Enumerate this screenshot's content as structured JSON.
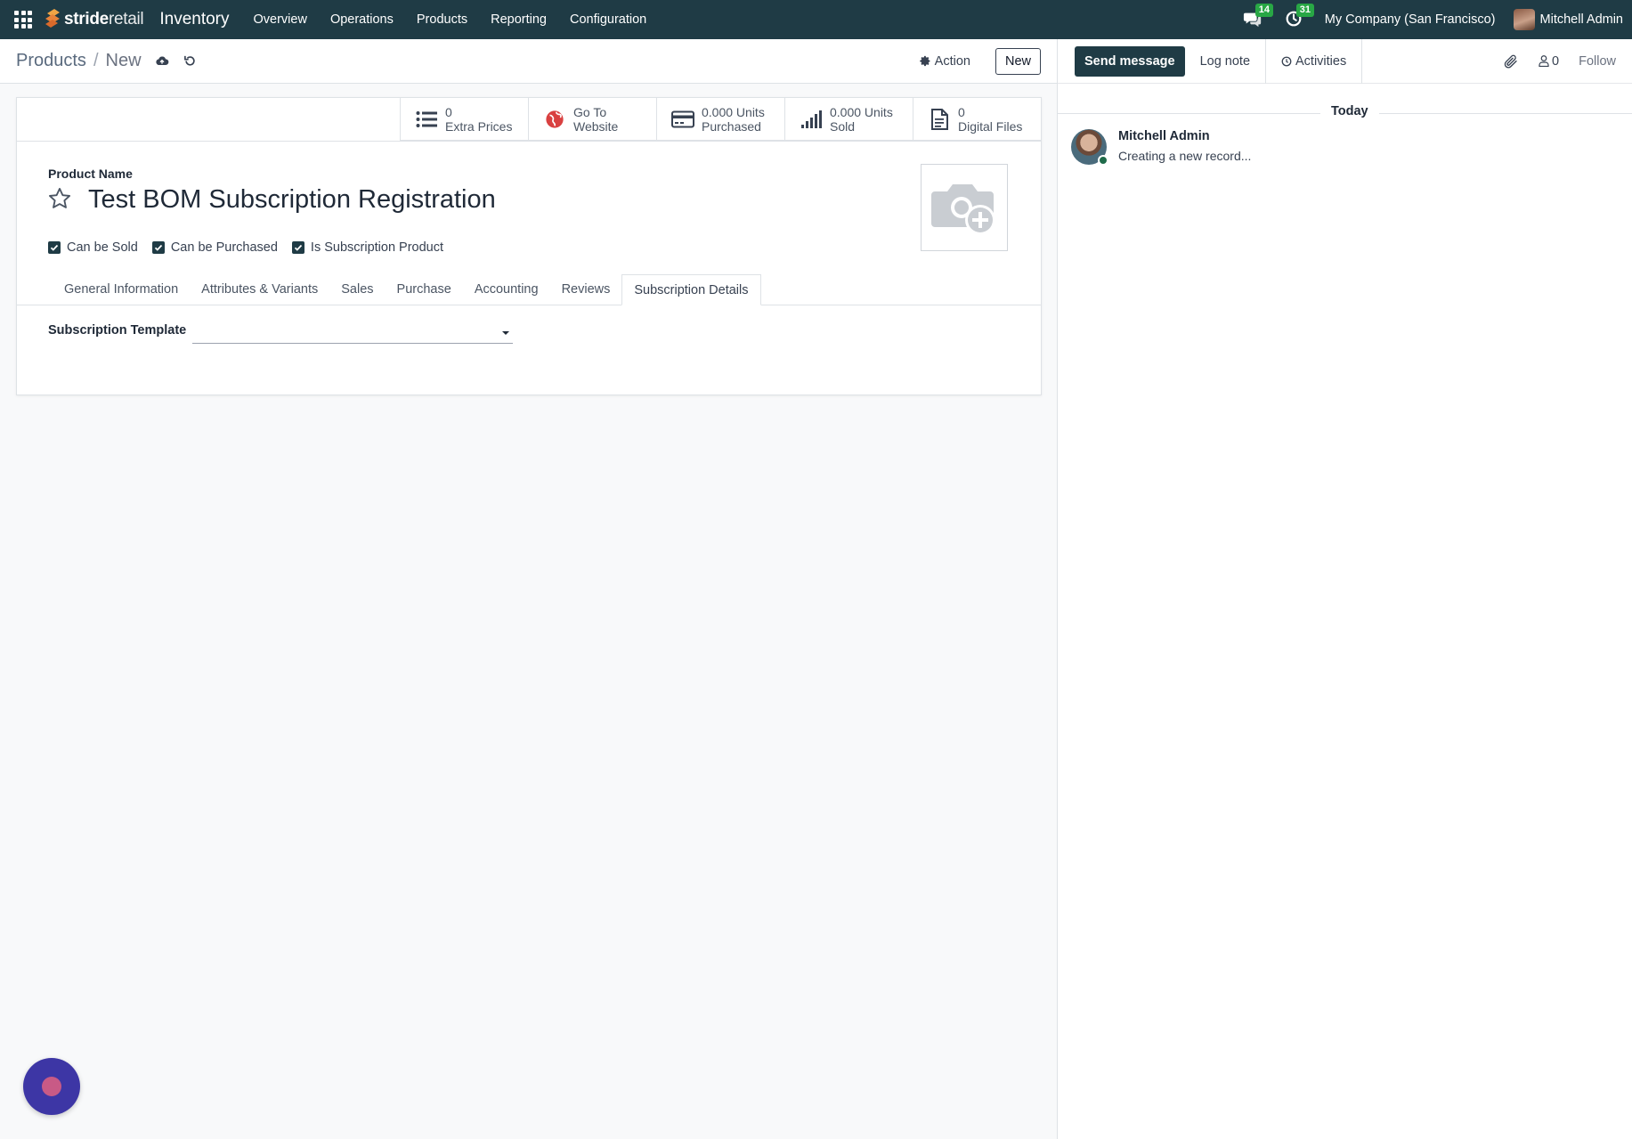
{
  "navbar": {
    "brand_bold": "stride",
    "brand_light": "retail",
    "app_name": "Inventory",
    "menu": [
      "Overview",
      "Operations",
      "Products",
      "Reporting",
      "Configuration"
    ],
    "messages_count": "14",
    "activities_count": "31",
    "company": "My Company (San Francisco)",
    "user": "Mitchell Admin"
  },
  "control": {
    "breadcrumb_parent": "Products",
    "breadcrumb_sep": "/",
    "breadcrumb_current": "New",
    "action_label": "Action",
    "new_label": "New"
  },
  "stats": [
    {
      "value": "0",
      "label": "Extra Prices",
      "icon": "list-icon"
    },
    {
      "value": "Go To",
      "label": "Website",
      "icon": "globe-icon"
    },
    {
      "value": "0.000 Units",
      "label": "Purchased",
      "icon": "credit-card-icon"
    },
    {
      "value": "0.000 Units",
      "label": "Sold",
      "icon": "signal-icon"
    },
    {
      "value": "0",
      "label": "Digital Files",
      "icon": "file-icon"
    }
  ],
  "form": {
    "product_name_label": "Product Name",
    "product_name": "Test BOM Subscription Registration",
    "checkboxes": [
      {
        "label": "Can be Sold",
        "checked": true
      },
      {
        "label": "Can be Purchased",
        "checked": true
      },
      {
        "label": "Is Subscription Product",
        "checked": true
      }
    ],
    "tabs": [
      "General Information",
      "Attributes & Variants",
      "Sales",
      "Purchase",
      "Accounting",
      "Reviews",
      "Subscription Details"
    ],
    "active_tab": "Subscription Details",
    "subscription_template_label": "Subscription Template",
    "subscription_template_value": ""
  },
  "chatter": {
    "send_message": "Send message",
    "log_note": "Log note",
    "activities": "Activities",
    "followers_count": "0",
    "follow": "Follow",
    "date_separator": "Today",
    "messages": [
      {
        "author": "Mitchell Admin",
        "body": "Creating a new record..."
      }
    ]
  },
  "colors": {
    "navbar_bg": "#1f3b45",
    "primary": "#1f3b45",
    "badge": "#28a745",
    "bubble": "#3d36a5"
  }
}
